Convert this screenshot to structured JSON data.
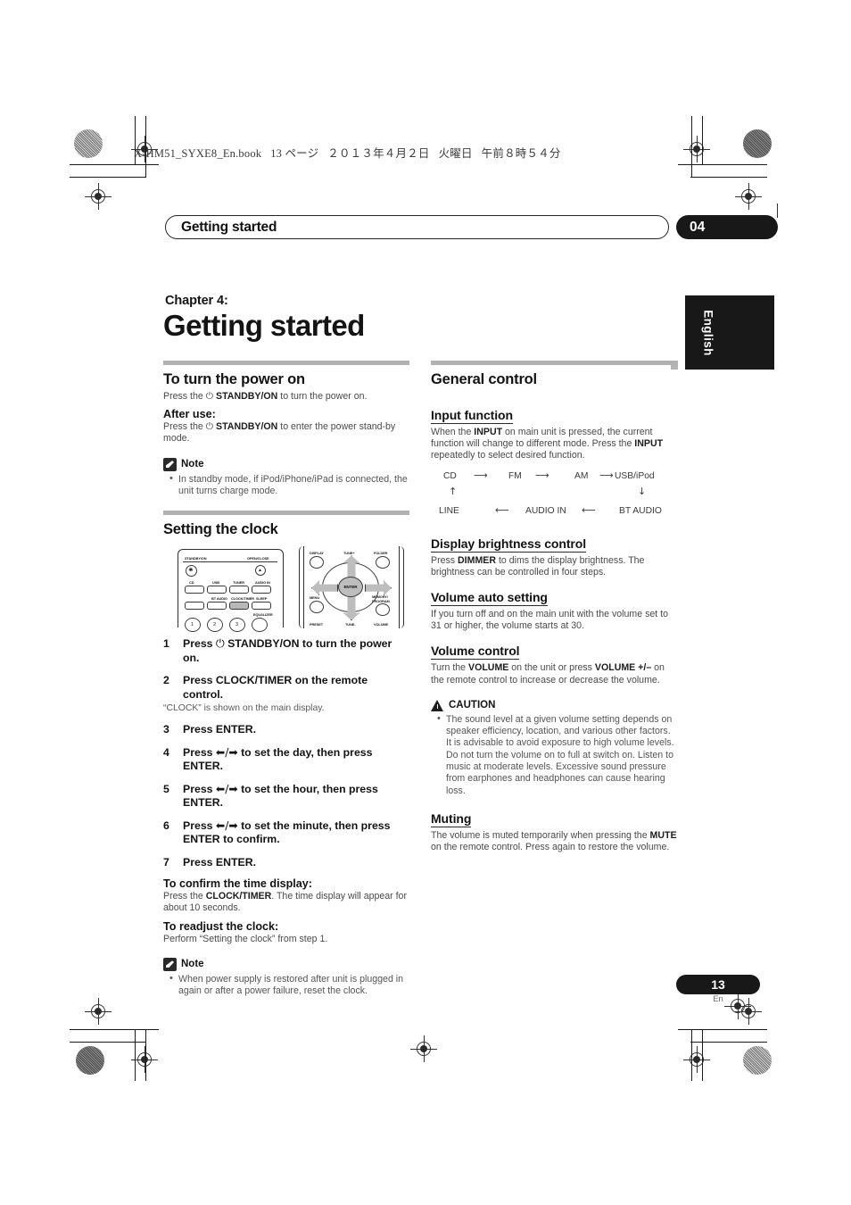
{
  "print_header": {
    "filename": "X-HM51_SYXE8_En.book",
    "page_marker": "13 ページ",
    "date": "２０１３年４月２日",
    "weekday": "火曜日",
    "time": "午前８時５４分"
  },
  "running_head": {
    "title": "Getting started",
    "chapter_number": "04"
  },
  "side_tab": {
    "language": "English"
  },
  "chapter": {
    "label": "Chapter 4:",
    "title": "Getting started"
  },
  "left_column": {
    "power_section": {
      "heading": "To turn the power on",
      "intro_prefix": "Press the ",
      "intro_glyph": "⏻",
      "intro_bold": "STANDBY/ON",
      "intro_suffix": " to turn the power on.",
      "after_use_heading": "After use:",
      "after_use_prefix": "Press the ",
      "after_use_glyph": "⏻",
      "after_use_bold": "STANDBY/ON",
      "after_use_suffix": " to enter the power stand-by mode.",
      "note_title": "Note",
      "note_items": [
        "In standby mode, if iPod/iPhone/iPad is connected, the unit turns charge mode."
      ]
    },
    "clock_section": {
      "heading": "Setting the clock",
      "remote_labels": {
        "standby_on": "STANDBY/ON",
        "open_close": "OPEN/CLOSE",
        "cd": "CD",
        "usb": "USB",
        "tuner": "TUNER",
        "audio_in": "AUDIO IN",
        "bt_audio": "BT AUDIO",
        "clock_timer": "CLOCK/TIMER",
        "sleep": "SLEEP",
        "equalizer": "EQUALIZER",
        "key1": "1",
        "key2": "2",
        "key3": "3",
        "display": "DISPLAY",
        "tune_plus": "TUNE+",
        "folder": "FOLDER",
        "menu": "MENU",
        "memory_program": "MEMORY/\nPROGRAM",
        "enter": "ENTER",
        "preset": "PRESET",
        "tune_minus": "TUNE-",
        "volume": "VOLUME"
      },
      "steps": [
        {
          "num": "1",
          "text_pre": "Press ",
          "glyph": "⏻",
          "text_post": " STANDBY/ON to turn the power on.",
          "note": ""
        },
        {
          "num": "2",
          "text_pre": "Press CLOCK/TIMER on the remote control.",
          "glyph": "",
          "text_post": "",
          "note": "“CLOCK” is shown on the main display."
        },
        {
          "num": "3",
          "text_pre": "Press ENTER.",
          "glyph": "",
          "text_post": "",
          "note": ""
        },
        {
          "num": "4",
          "text_pre": "Press ",
          "glyph": "⬅/➡",
          "text_post": " to set the day, then press ENTER.",
          "note": ""
        },
        {
          "num": "5",
          "text_pre": "Press ",
          "glyph": "⬅/➡",
          "text_post": " to set the hour, then press ENTER.",
          "note": ""
        },
        {
          "num": "6",
          "text_pre": "Press ",
          "glyph": "⬅/➡",
          "text_post": " to set the minute, then press ENTER to confirm.",
          "note": ""
        },
        {
          "num": "7",
          "text_pre": "Press ENTER.",
          "glyph": "",
          "text_post": "",
          "note": ""
        }
      ],
      "confirm_heading": "To confirm the time display:",
      "confirm_pre": "Press the ",
      "confirm_bold": "CLOCK/TIMER",
      "confirm_post": ". The time display will appear for about 10 seconds.",
      "readjust_heading": "To readjust the clock:",
      "readjust_text": "Perform “Setting the clock” from step 1.",
      "note_title": "Note",
      "note_items": [
        "When power supply is restored after unit is plugged in again or after a power failure, reset the clock."
      ]
    }
  },
  "right_column": {
    "heading": "General control",
    "input_function": {
      "heading": "Input function",
      "text_parts": {
        "p1": "When the ",
        "b1": "INPUT",
        "p2": " on main unit is pressed, the current function will change to different mode. Press the ",
        "b2": "INPUT",
        "p3": " repeatedly to select desired function."
      },
      "flow_top": [
        "CD",
        "FM",
        "AM",
        "USB/iPod"
      ],
      "flow_bottom": [
        "LINE",
        "AUDIO IN",
        "BT AUDIO"
      ],
      "arrow_right": "⟶",
      "arrow_left": "⟵",
      "arrow_up": "↑",
      "arrow_down": "↓"
    },
    "display_brightness": {
      "heading": "Display brightness control",
      "p1": "Press ",
      "b1": "DIMMER",
      "p2": " to dims the display brightness. The brightness can be controlled in four steps."
    },
    "volume_auto": {
      "heading": "Volume auto setting",
      "text": "If you turn off and on the main unit with the volume set to 31 or higher, the volume starts at 30."
    },
    "volume_control": {
      "heading": "Volume control",
      "p1": "Turn the ",
      "b1": "VOLUME",
      "p2": " on the unit or press ",
      "b2": "VOLUME +/–",
      "p3": " on the remote control to increase or decrease the volume.",
      "caution_title": "CAUTION",
      "caution_items": [
        "The sound level at a given volume setting depends on speaker efficiency, location, and various other factors. It is advisable to avoid exposure to high volume levels. Do not turn the volume on to full at switch on. Listen to music at moderate levels. Excessive sound pressure from earphones and headphones can cause hearing loss."
      ]
    },
    "muting": {
      "heading": "Muting",
      "p1": "The volume is muted temporarily when pressing the ",
      "b1": "MUTE",
      "p2": " on the remote control. Press again to restore the volume."
    }
  },
  "footer": {
    "page_number": "13",
    "language_code": "En"
  }
}
